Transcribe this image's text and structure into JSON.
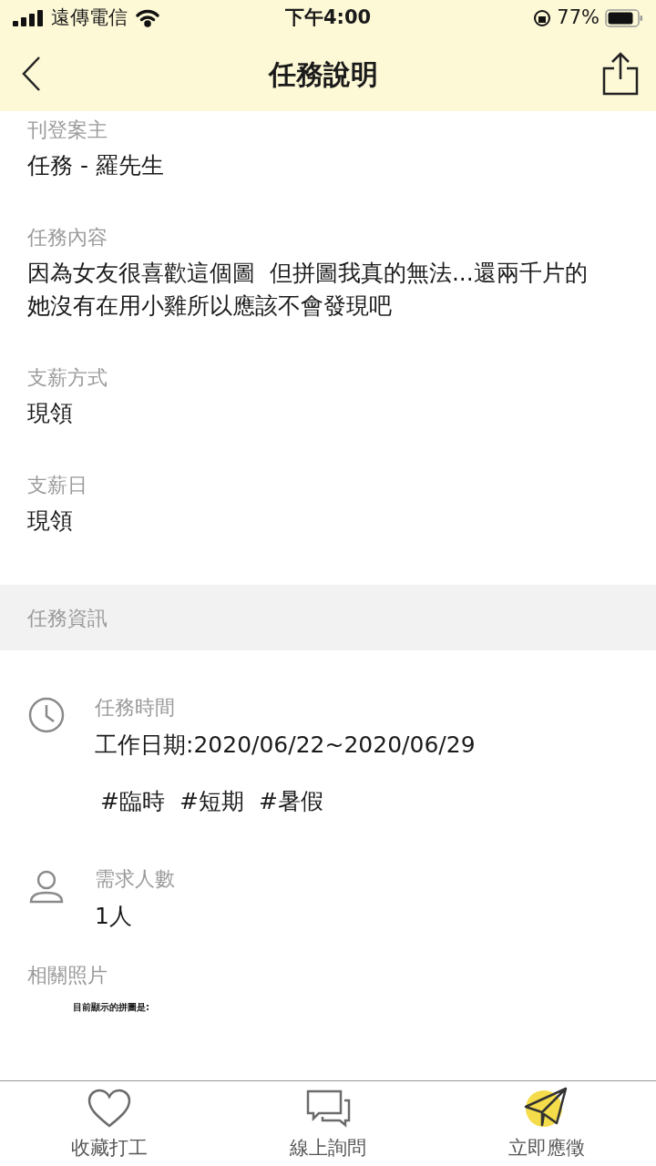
{
  "status_bar": {
    "carrier": "遠傳電信",
    "time": "下午4:00",
    "battery": "77%"
  },
  "nav": {
    "title": "任務說明"
  },
  "fields": [
    {
      "label": "刊登案主",
      "lines": [
        "任務 - 羅先生"
      ]
    },
    {
      "label": "任務內容",
      "lines": [
        "因為女友很喜歡這個圖  但拼圖我真的無法...還兩千片的",
        "她沒有在用小雞所以應該不會發現吧"
      ]
    },
    {
      "label": "支薪方式",
      "lines": [
        "現領"
      ]
    },
    {
      "label": "支薪日",
      "lines": [
        "現領"
      ]
    }
  ],
  "info_section": {
    "title": "任務資訊",
    "items": [
      {
        "kind": "time",
        "label": "任務時間",
        "value": "工作日期:2020/06/22~2020/06/29",
        "tags": [
          "#臨時",
          "#短期",
          "#暑假"
        ]
      },
      {
        "kind": "people",
        "label": "需求人數",
        "value": "1人"
      }
    ]
  },
  "photos": {
    "label": "相關照片",
    "caption": "目前顯示的拼圖是:"
  },
  "bottom_bar": [
    {
      "kind": "favorite",
      "label": "收藏打工"
    },
    {
      "kind": "chat",
      "label": "線上詢問"
    },
    {
      "kind": "apply",
      "label": "立即應徵"
    }
  ]
}
